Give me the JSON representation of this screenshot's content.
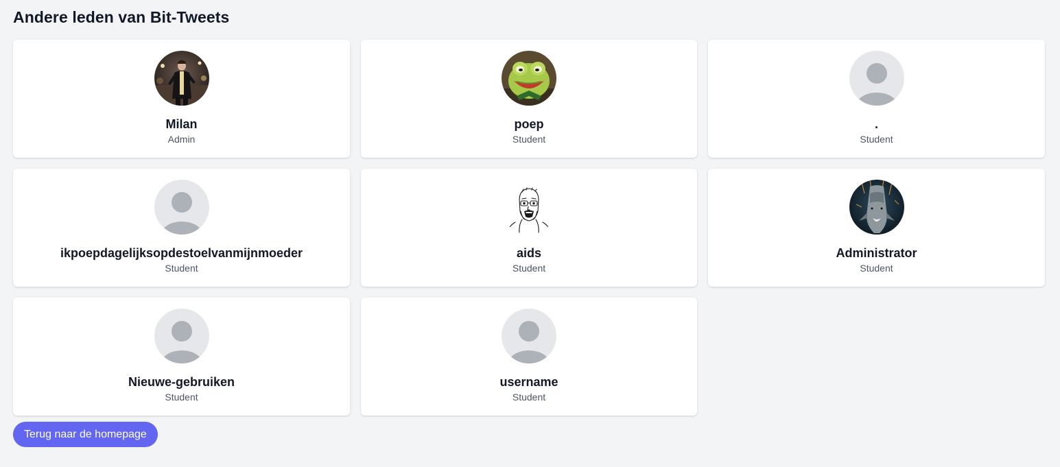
{
  "header": {
    "title": "Andere leden van Bit-Tweets"
  },
  "members": [
    {
      "name": "Milan",
      "role": "Admin",
      "avatar": "photo-man-night-street"
    },
    {
      "name": "poep",
      "role": "Student",
      "avatar": "photo-frog-puppet"
    },
    {
      "name": ".",
      "role": "Student",
      "avatar": "default-user-icon"
    },
    {
      "name": "ikpoepdagelijksopdestoelvanmijnmoeder",
      "role": "Student",
      "avatar": "default-user-icon"
    },
    {
      "name": "aids",
      "role": "Student",
      "avatar": "soyjak-drawing"
    },
    {
      "name": "Administrator",
      "role": "Student",
      "avatar": "photo-shark-dark"
    },
    {
      "name": "Nieuwe-gebruiken",
      "role": "Student",
      "avatar": "default-user-icon"
    },
    {
      "name": "username",
      "role": "Student",
      "avatar": "default-user-icon"
    }
  ],
  "footer": {
    "back_label": "Terug naar de homepage"
  },
  "colors": {
    "background": "#f3f4f6",
    "card": "#ffffff",
    "accent": "#6366f1",
    "avatar_placeholder_bg": "#e5e7eb",
    "avatar_placeholder_fg": "#adb1b8"
  }
}
